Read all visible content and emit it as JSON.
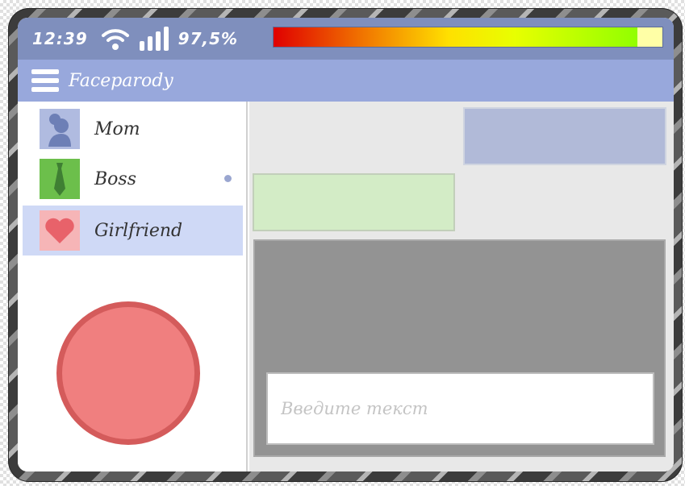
{
  "status_bar": {
    "time": "12:39",
    "battery_percent_text": "97,5%",
    "battery_level": 0.935,
    "icons": [
      "wifi-icon",
      "signal-bars-icon"
    ]
  },
  "header": {
    "menu_icon": "hamburger-menu-icon",
    "app_title": "Faceparody"
  },
  "contacts": [
    {
      "name": "Mom",
      "icon": "mom-silhouette-icon",
      "color": "#b0bbe0",
      "unread": false,
      "active": false
    },
    {
      "name": "Boss",
      "icon": "necktie-icon",
      "color": "#6cbf4b",
      "unread": true,
      "active": false
    },
    {
      "name": "Girlfriend",
      "icon": "heart-icon",
      "color": "#f6b5b7",
      "active": true,
      "unread": false
    }
  ],
  "call_button": {
    "color": "#f07f7f",
    "border_color": "#d45b5b"
  },
  "chat": {
    "outgoing_bubble_color": "#b1bad8",
    "incoming_bubble_color": "#d3ecc6",
    "input_placeholder": "Введите текст",
    "input_value": ""
  }
}
